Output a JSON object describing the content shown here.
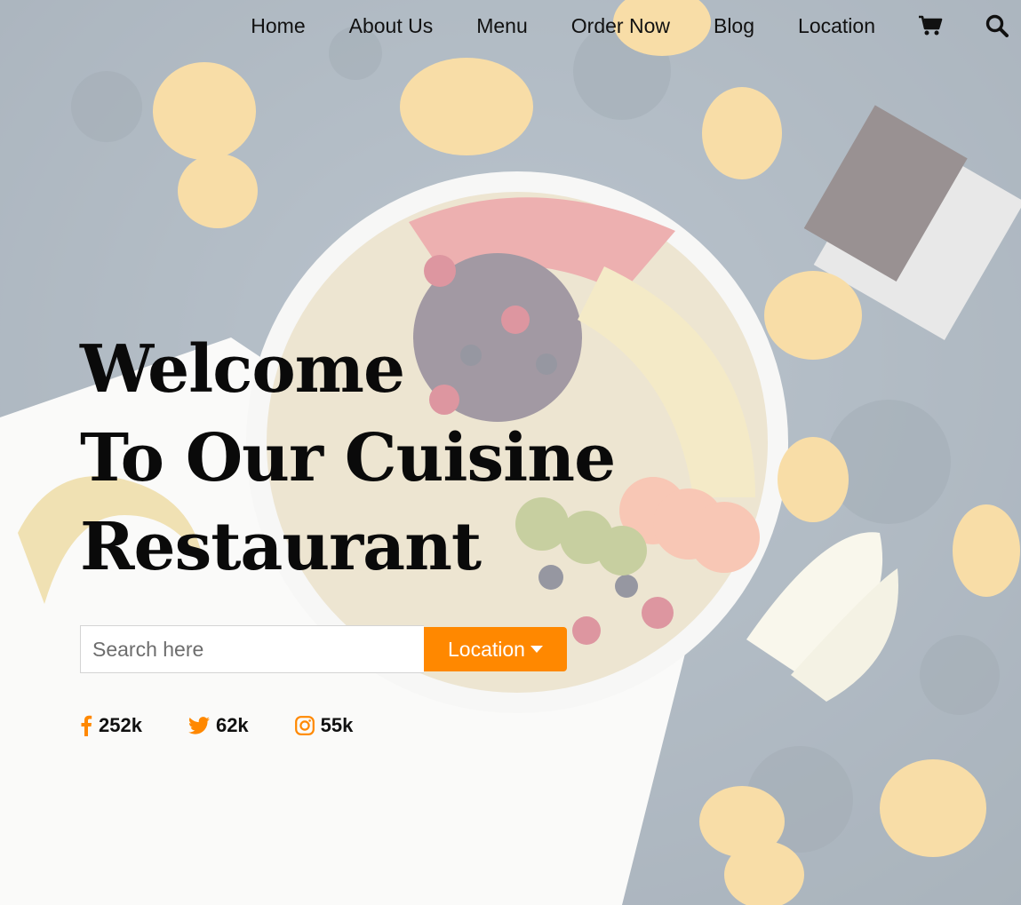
{
  "nav": {
    "items": [
      {
        "label": "Home"
      },
      {
        "label": "About Us"
      },
      {
        "label": "Menu"
      },
      {
        "label": "Order Now"
      },
      {
        "label": "Blog"
      },
      {
        "label": "Location"
      }
    ],
    "icons": [
      "cart-icon",
      "search-icon"
    ]
  },
  "hero": {
    "line1": "Welcome",
    "line2": "To Our Cuisine",
    "line3": "Restaurant"
  },
  "search": {
    "placeholder": "Search here",
    "value": "",
    "location_label": "Location",
    "location_icon": "caret-down-icon"
  },
  "social": [
    {
      "icon": "facebook-icon",
      "count": "252k"
    },
    {
      "icon": "twitter-icon",
      "count": "62k"
    },
    {
      "icon": "instagram-icon",
      "count": "55k"
    }
  ],
  "colors": {
    "accent": "#ff8800",
    "text": "#111111",
    "background": "#9aa8b6"
  }
}
